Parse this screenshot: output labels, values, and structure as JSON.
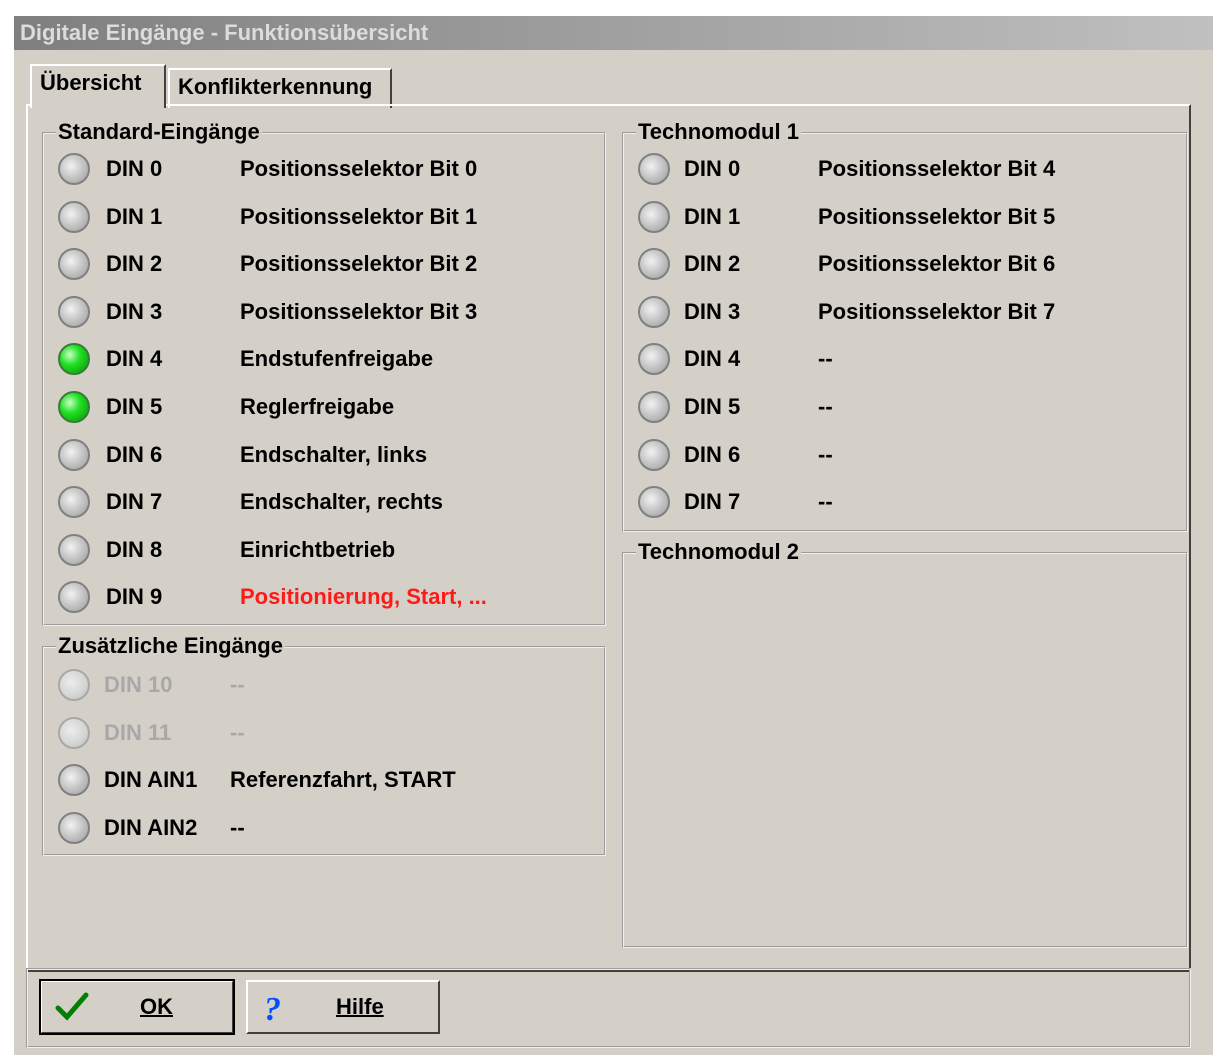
{
  "window": {
    "title": "Digitale Eingänge - Funktionsübersicht"
  },
  "tabs": [
    {
      "label": "Übersicht",
      "active": true
    },
    {
      "label": "Konflikterkennung",
      "active": false
    }
  ],
  "standard": {
    "title": "Standard-Eingänge",
    "rows": [
      {
        "name": "DIN 0",
        "func": "Positionsselektor Bit 0",
        "state": "off"
      },
      {
        "name": "DIN 1",
        "func": "Positionsselektor Bit 1",
        "state": "off"
      },
      {
        "name": "DIN 2",
        "func": "Positionsselektor Bit 2",
        "state": "off"
      },
      {
        "name": "DIN 3",
        "func": "Positionsselektor Bit 3",
        "state": "off"
      },
      {
        "name": "DIN 4",
        "func": "Endstufenfreigabe",
        "state": "on"
      },
      {
        "name": "DIN 5",
        "func": "Reglerfreigabe",
        "state": "on"
      },
      {
        "name": "DIN 6",
        "func": "Endschalter, links",
        "state": "off"
      },
      {
        "name": "DIN 7",
        "func": "Endschalter, rechts",
        "state": "off"
      },
      {
        "name": "DIN 8",
        "func": "Einrichtbetrieb",
        "state": "off"
      },
      {
        "name": "DIN 9",
        "func": "Positionierung, Start, ...",
        "state": "off",
        "highlight": true
      }
    ]
  },
  "extra": {
    "title": "Zusätzliche Eingänge",
    "rows": [
      {
        "name": "DIN 10",
        "func": "--",
        "state": "disabled"
      },
      {
        "name": "DIN 11",
        "func": "--",
        "state": "disabled"
      },
      {
        "name": "DIN AIN1",
        "func": "Referenzfahrt, START",
        "state": "off"
      },
      {
        "name": "DIN AIN2",
        "func": "--",
        "state": "off"
      }
    ]
  },
  "techno1": {
    "title": "Technomodul 1",
    "rows": [
      {
        "name": "DIN 0",
        "func": "Positionsselektor Bit 4",
        "state": "off"
      },
      {
        "name": "DIN 1",
        "func": "Positionsselektor Bit 5",
        "state": "off"
      },
      {
        "name": "DIN 2",
        "func": "Positionsselektor Bit 6",
        "state": "off"
      },
      {
        "name": "DIN 3",
        "func": "Positionsselektor Bit 7",
        "state": "off"
      },
      {
        "name": "DIN 4",
        "func": "--",
        "state": "off"
      },
      {
        "name": "DIN 5",
        "func": "--",
        "state": "off"
      },
      {
        "name": "DIN 6",
        "func": "--",
        "state": "off"
      },
      {
        "name": "DIN 7",
        "func": "--",
        "state": "off"
      }
    ]
  },
  "techno2": {
    "title": "Technomodul 2"
  },
  "buttons": {
    "ok": {
      "label": "OK",
      "icon": "checkmark-icon"
    },
    "help": {
      "label": "Hilfe",
      "icon": "question-icon"
    }
  },
  "colors": {
    "led_on": "#22e022",
    "highlight": "#ff1a1a",
    "face": "#d4d0c8"
  }
}
